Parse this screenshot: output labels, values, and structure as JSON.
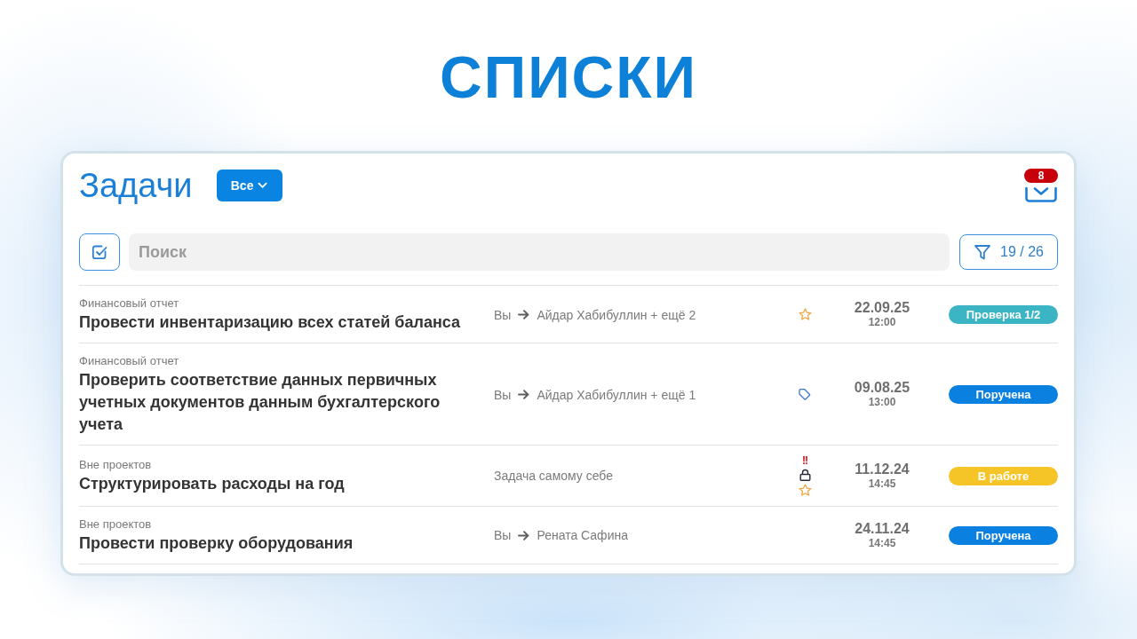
{
  "heading": "СПИСКИ",
  "panel": {
    "title": "Задачи",
    "scope_dropdown": {
      "label": "Все"
    },
    "inbox": {
      "badge": "8"
    }
  },
  "toolbar": {
    "search": {
      "placeholder": "Поиск"
    },
    "filter": {
      "count": "19 / 26"
    }
  },
  "tasks": [
    {
      "project": "Финансовый отчет",
      "title": "Провести инвентаризацию всех статей баланса",
      "assignment": {
        "kind": "transfer",
        "from": "Вы",
        "to": "Айдар Хабибуллин + ещё 2"
      },
      "markers": [
        {
          "kind": "star"
        }
      ],
      "date": "22.09.25",
      "time": "12:00",
      "status": {
        "label": "Проверка 1/2",
        "color": "#3bb5c3"
      }
    },
    {
      "project": "Финансовый отчет",
      "title": "Проверить соответствие данных первичных учетных документов данным бухгалтерского учета",
      "assignment": {
        "kind": "transfer",
        "from": "Вы",
        "to": "Айдар Хабибуллин + ещё 1"
      },
      "markers": [
        {
          "kind": "tag"
        }
      ],
      "date": "09.08.25",
      "time": "13:00",
      "status": {
        "label": "Поручена",
        "color": "#0a80e0"
      }
    },
    {
      "project": "Вне проектов",
      "title": "Структурировать расходы на год",
      "assignment": {
        "kind": "self",
        "text": "Задача самому себе"
      },
      "markers": [
        {
          "kind": "priority",
          "text": "!!"
        },
        {
          "kind": "lock"
        },
        {
          "kind": "star"
        }
      ],
      "date": "11.12.24",
      "time": "14:45",
      "status": {
        "label": "В работе",
        "color": "#f5c426"
      }
    },
    {
      "project": "Вне проектов",
      "title": "Провести проверку оборудования",
      "assignment": {
        "kind": "transfer",
        "from": "Вы",
        "to": "Рената Сафина"
      },
      "date": "24.11.24",
      "time": "14:45",
      "status": {
        "label": "Поручена",
        "color": "#0a80e0"
      }
    }
  ]
}
